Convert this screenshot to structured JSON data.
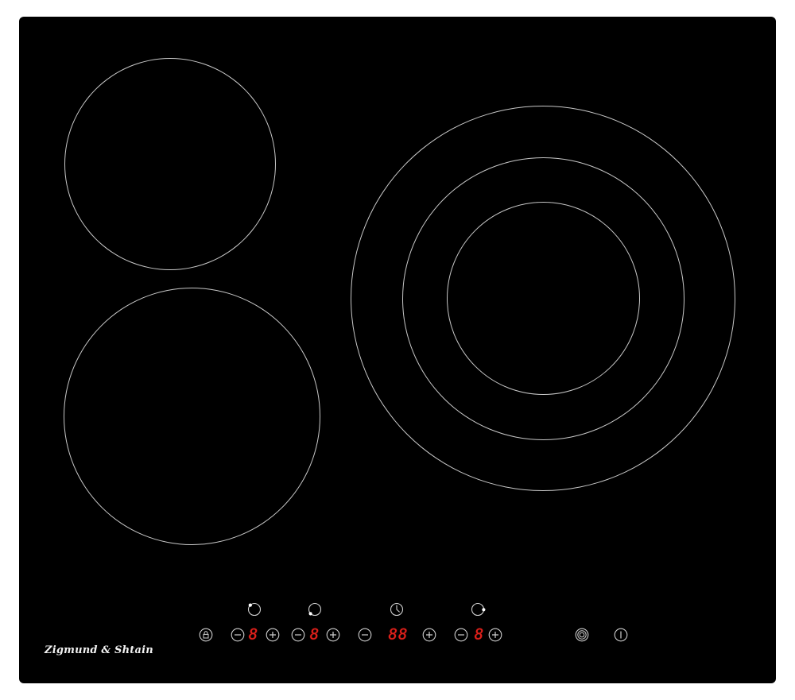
{
  "brand": {
    "logo_text": "Zigmund & Shtain"
  },
  "colors": {
    "surface": "#000000",
    "zone_outline": "#c8c8c8",
    "control_outline": "#cfcfcf",
    "display_digit": "#e3201b"
  },
  "zones": [
    {
      "name": "rear-left-zone",
      "rings": 1
    },
    {
      "name": "front-left-zone",
      "rings": 1
    },
    {
      "name": "right-triple-zone",
      "rings": 3
    }
  ],
  "control_panel": {
    "indicators": [
      {
        "name": "zone-indicator-front-left",
        "icon": "zone-position-icon"
      },
      {
        "name": "zone-indicator-rear-left",
        "icon": "zone-position-icon"
      },
      {
        "name": "timer-indicator",
        "icon": "clock-icon"
      },
      {
        "name": "zone-indicator-right",
        "icon": "zone-position-icon"
      }
    ],
    "buttons": [
      {
        "name": "lock-button",
        "icon": "lock-icon"
      },
      {
        "name": "minus-button",
        "icon": "minus-icon"
      },
      {
        "name": "plus-button",
        "icon": "plus-icon"
      },
      {
        "name": "dual-ring-button",
        "icon": "dual-ring-icon"
      },
      {
        "name": "power-button",
        "icon": "power-icon"
      }
    ],
    "displays": {
      "zone1_power": "8",
      "zone2_power": "8",
      "timer": "88",
      "zone3_power": "8"
    }
  }
}
